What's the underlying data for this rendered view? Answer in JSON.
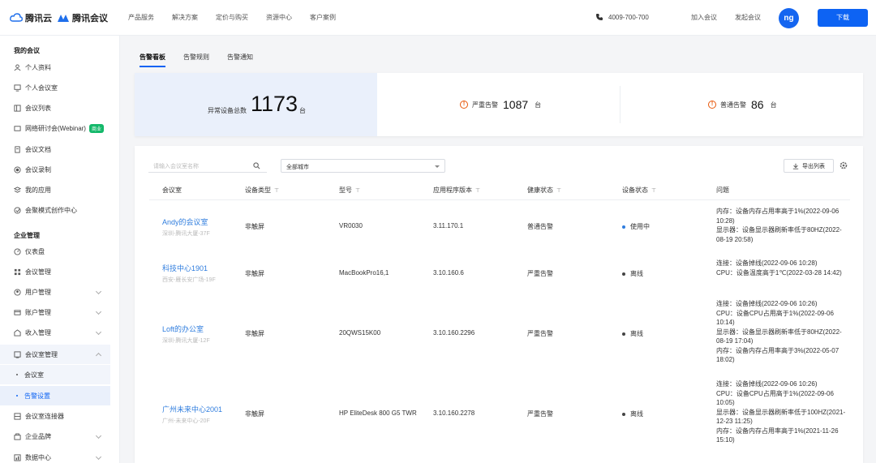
{
  "header": {
    "brand_cloud": "腾讯云",
    "brand_meeting": "腾讯会议",
    "nav": [
      "产品服务",
      "解决方案",
      "定价与购买",
      "资源中心",
      "客户案例"
    ],
    "phone": "4009-700-700",
    "join_meeting": "加入会议",
    "start_meeting": "发起会议",
    "avatar_initials": "ng",
    "download": "下载"
  },
  "sidebar": {
    "section_my": "我的会议",
    "my_items": [
      {
        "label": "个人资料",
        "icon": "user-icon"
      },
      {
        "label": "个人会议室",
        "icon": "monitor-icon"
      },
      {
        "label": "会议列表",
        "icon": "list-icon"
      },
      {
        "label": "网络研讨会(Webinar)",
        "icon": "webinar-icon",
        "badge": "商业"
      },
      {
        "label": "会议文档",
        "icon": "document-icon"
      },
      {
        "label": "会议录制",
        "icon": "record-icon"
      },
      {
        "label": "我的应用",
        "icon": "apps-icon"
      },
      {
        "label": "会聚模式创作中心",
        "icon": "create-icon"
      }
    ],
    "section_enterprise": "企业管理",
    "ent_items": [
      {
        "label": "仪表盘",
        "icon": "dashboard-icon"
      },
      {
        "label": "会议管理",
        "icon": "grid-icon"
      },
      {
        "label": "用户管理",
        "icon": "users-icon"
      },
      {
        "label": "账户管理",
        "icon": "account-icon"
      },
      {
        "label": "收入管理",
        "icon": "income-icon"
      },
      {
        "label": "会议室管理",
        "icon": "room-icon"
      }
    ],
    "room_sub": [
      "会议室",
      "告警设置"
    ],
    "ent_items_after": [
      {
        "label": "会议室连接器",
        "icon": "connector-icon"
      },
      {
        "label": "企业品牌",
        "icon": "brand-icon"
      },
      {
        "label": "数据中心",
        "icon": "data-icon"
      }
    ]
  },
  "tabs": [
    "告警看板",
    "告警规则",
    "告警通知"
  ],
  "stats": {
    "total_label": "异常设备总数",
    "total_value": "1173",
    "unit": "台",
    "severe_label": "严重告警",
    "severe_value": "1087",
    "normal_label": "普通告警",
    "normal_value": "86"
  },
  "filters": {
    "search_placeholder": "请输入会议室名称",
    "city_select": "全部城市",
    "export": "导出列表"
  },
  "table": {
    "headers": [
      "会议室",
      "设备类型",
      "型号",
      "应用程序版本",
      "健康状态",
      "设备状态",
      "问题"
    ],
    "rows": [
      {
        "name": "Andy的会议室",
        "location": "深圳-腾讯大厦-37F",
        "device_type": "非触屏",
        "model": "VR0030",
        "version": "3.11.170.1",
        "health": "普通告警",
        "status": "使用中",
        "issues": [
          "内存：设备内存占用率高于1%(2022-09-06 10:28)",
          "显示器：设备显示器刷新率低于80HZ(2022-08-19 20:58)"
        ]
      },
      {
        "name": "科技中心1901",
        "location": "西安-雁长安广场-19F",
        "device_type": "非触屏",
        "model": "MacBookPro16,1",
        "version": "3.10.160.6",
        "health": "严重告警",
        "status": "离线",
        "issues": [
          "连接：设备掉线(2022-09-06 10:28)",
          "CPU：设备温度高于1℃(2022-03-28 14:42)"
        ]
      },
      {
        "name": "Loft的办公室",
        "location": "深圳-腾讯大厦-12F",
        "device_type": "非触屏",
        "model": "20QWS15K00",
        "version": "3.10.160.2296",
        "health": "严重告警",
        "status": "离线",
        "issues": [
          "连接：设备掉线(2022-09-06 10:26)",
          "CPU：设备CPU占用高于1%(2022-09-06 10:14)",
          "显示器：设备显示器刷新率低于80HZ(2022-08-19 17:04)",
          "内存：设备内存占用率高于3%(2022-05-07 18:02)"
        ]
      },
      {
        "name": "广州未来中心2001",
        "location": "广州-未来中心-20F",
        "device_type": "非触屏",
        "model": "HP EliteDesk 800 G5 TWR",
        "version": "3.10.160.2278",
        "health": "严重告警",
        "status": "离线",
        "issues": [
          "连接：设备掉线(2022-09-06 10:26)",
          "CPU：设备CPU占用高于1%(2022-09-06 10:05)",
          "显示器：设备显示器刷新率低于100HZ(2021-12-23 11:25)",
          "内存：设备内存占用率高于1%(2021-11-26 15:10)"
        ]
      }
    ]
  },
  "colors": {
    "accent": "#0d63f3",
    "link": "#2f7dde",
    "warn": "#e8590c",
    "online": "#2f7dde",
    "offline": "#444444"
  }
}
